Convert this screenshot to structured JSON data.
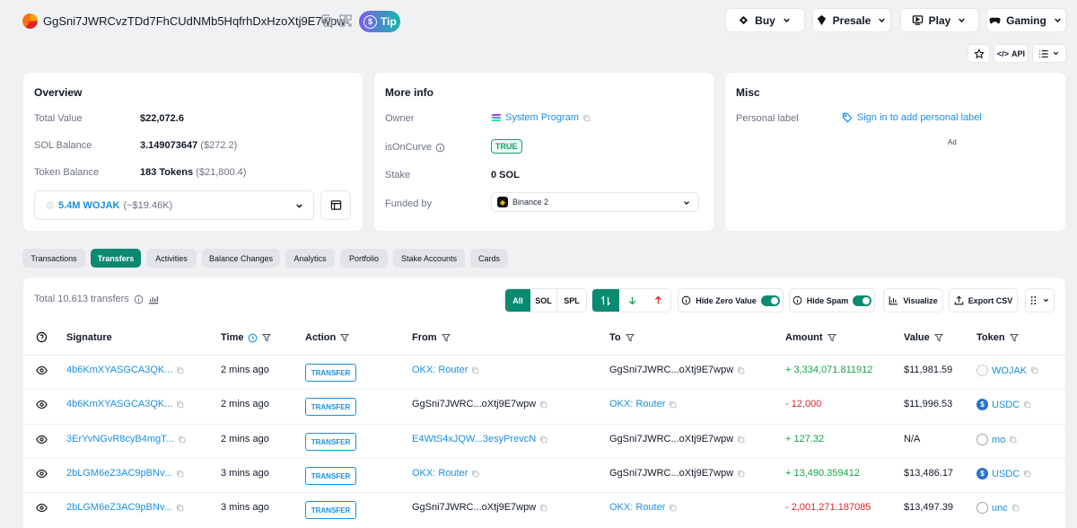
{
  "header": {
    "address": "GgSni7JWRCvzTDd7FhCUdNMb5HqfrhDxHzoXtj9E7wpw",
    "tip_label": "Tip",
    "tip_coin": "$",
    "nav": [
      "Buy",
      "Presale",
      "Play",
      "Gaming"
    ],
    "api_label": "API"
  },
  "overview": {
    "title": "Overview",
    "total_value_label": "Total Value",
    "total_value": "$22,072.6",
    "sol_balance_label": "SOL Balance",
    "sol_balance": "3.149073647",
    "sol_balance_usd": "($272.2)",
    "token_balance_label": "Token Balance",
    "token_balance": "183 Tokens",
    "token_balance_usd": "($21,800.4)",
    "token_select": "5.4M WOJAK",
    "token_select_usd": "(~$19.46K)"
  },
  "more_info": {
    "title": "More info",
    "owner_label": "Owner",
    "owner": "System Program",
    "oncurve_label": "isOnCurve",
    "oncurve": "TRUE",
    "stake_label": "Stake",
    "stake": "0 SOL",
    "funded_label": "Funded by",
    "funded": "Binance 2"
  },
  "misc": {
    "title": "Misc",
    "personal_label": "Personal label",
    "signin": "Sign in to add personal label",
    "ad": "Ad"
  },
  "tabs": [
    "Transactions",
    "Transfers",
    "Activities",
    "Balance Changes",
    "Analytics",
    "Portfolio",
    "Stake Accounts",
    "Cards"
  ],
  "active_tab": "Transfers",
  "toolbar": {
    "total": "Total 10,613 transfers",
    "filters": [
      "All",
      "SOL",
      "SPL"
    ],
    "hide_zero": "Hide Zero Value",
    "hide_spam": "Hide Spam",
    "visualize": "Visualize",
    "export": "Export CSV"
  },
  "table": {
    "headers": [
      "Signature",
      "Time",
      "Action",
      "From",
      "To",
      "Amount",
      "Value",
      "Token"
    ],
    "rows": [
      {
        "signature": "4b6KmXYASGCA3QK...",
        "time": "2 mins ago",
        "action": "TRANSFER",
        "from": "OKX: Router",
        "from_link": true,
        "to": "GgSni7JWRC...oXtj9E7wpw",
        "to_link": false,
        "amount": "+ 3,334,071.811912",
        "sign": "pos",
        "value": "$11,981.59",
        "token": "WOJAK",
        "token_icon": "wojak"
      },
      {
        "signature": "4b6KmXYASGCA3QK...",
        "time": "2 mins ago",
        "action": "TRANSFER",
        "from": "GgSni7JWRC...oXtj9E7wpw",
        "from_link": false,
        "to": "OKX: Router",
        "to_link": true,
        "amount": "- 12,000",
        "sign": "neg",
        "value": "$11,996.53",
        "token": "USDC",
        "token_icon": "usdc"
      },
      {
        "signature": "3ErYvNGvR8cyB4mgT...",
        "time": "2 mins ago",
        "action": "TRANSFER",
        "from": "E4WtS4xJQW...3esyPrevcN",
        "from_link": true,
        "to": "GgSni7JWRC...oXtj9E7wpw",
        "to_link": false,
        "amount": "+ 127.32",
        "sign": "pos",
        "value": "N/A",
        "token": "mo",
        "token_icon": "generic"
      },
      {
        "signature": "2bLGM6eZ3AC9pBNv...",
        "time": "3 mins ago",
        "action": "TRANSFER",
        "from": "OKX: Router",
        "from_link": true,
        "to": "GgSni7JWRC...oXtj9E7wpw",
        "to_link": false,
        "amount": "+ 13,490.359412",
        "sign": "pos",
        "value": "$13,486.17",
        "token": "USDC",
        "token_icon": "usdc"
      },
      {
        "signature": "2bLGM6eZ3AC9pBNv...",
        "time": "3 mins ago",
        "action": "TRANSFER",
        "from": "GgSni7JWRC...oXtj9E7wpw",
        "from_link": false,
        "to": "OKX: Router",
        "to_link": true,
        "amount": "- 2,001,271.187085",
        "sign": "neg",
        "value": "$13,497.39",
        "token": "unc",
        "token_icon": "generic"
      }
    ]
  },
  "colors": {
    "accent": "#0a8a71",
    "link": "#1a8fe3",
    "positive": "#16a34a",
    "negative": "#dc2626"
  }
}
